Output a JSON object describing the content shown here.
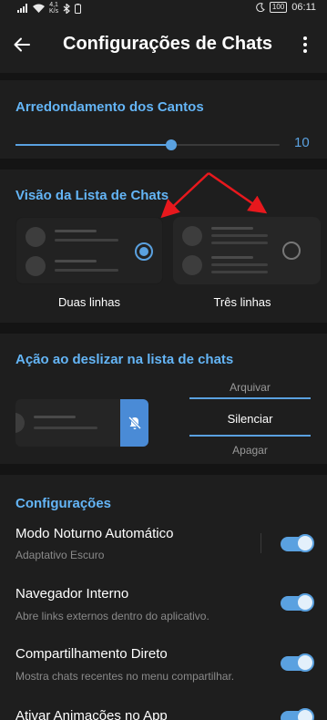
{
  "status": {
    "speed_value": "4,1",
    "speed_unit": "K/s",
    "battery": "100",
    "time": "06:11"
  },
  "header": {
    "title": "Configurações de Chats"
  },
  "corners": {
    "title": "Arredondamento dos Cantos",
    "value": "10",
    "slider_fraction": 0.59
  },
  "chat_list_view": {
    "title": "Visão da Lista de Chats",
    "options": [
      {
        "label": "Duas linhas",
        "selected": true
      },
      {
        "label": "Três linhas",
        "selected": false
      }
    ]
  },
  "swipe": {
    "title": "Ação ao deslizar na lista de chats",
    "options": [
      "Arquivar",
      "Silenciar",
      "Apagar"
    ],
    "selected": "Silenciar"
  },
  "settings": {
    "title": "Configurações",
    "items": [
      {
        "title": "Modo Noturno Automático",
        "subtitle": "Adaptativo Escuro",
        "enabled": true
      },
      {
        "title": "Navegador Interno",
        "subtitle": "Abre links externos dentro do aplicativo.",
        "enabled": true
      },
      {
        "title": "Compartilhamento Direto",
        "subtitle": "Mostra chats recentes no menu compartilhar.",
        "enabled": true
      },
      {
        "title": "Ativar Animações no App",
        "subtitle": "",
        "enabled": true
      }
    ]
  },
  "colors": {
    "accent": "#5aa1e0",
    "background": "#141414",
    "surface": "#1e1e1e",
    "annotation_arrow": "#e8181d"
  },
  "icons": [
    "signal-icon",
    "wifi-icon",
    "bluetooth-icon",
    "battery-icon",
    "moon-icon",
    "back-arrow-icon",
    "more-vert-icon",
    "mute-icon"
  ]
}
